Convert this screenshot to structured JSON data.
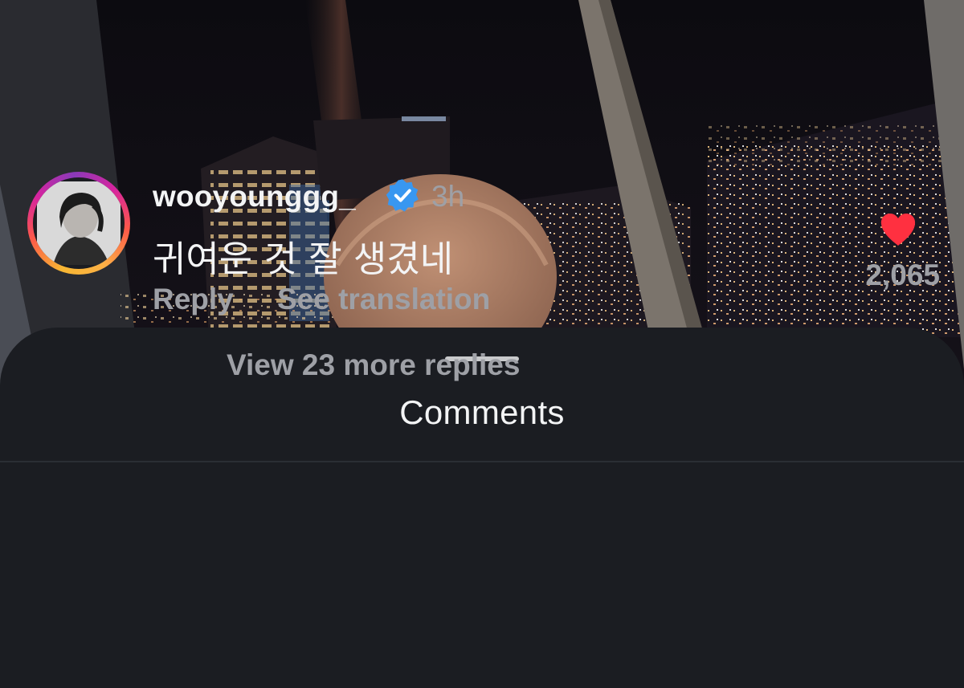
{
  "sheet": {
    "title": "Comments"
  },
  "comment": {
    "username": "wooyounggg_",
    "verified": true,
    "time": "3h",
    "text": "귀여운 것 잘 생겼네",
    "reply_label": "Reply",
    "translate_label": "See translation",
    "like_count": "2,065",
    "liked": true,
    "view_replies_label": "View 23 more replies"
  },
  "colors": {
    "sheet_bg": "#1b1d22",
    "text_primary": "#f3f4f5",
    "text_secondary": "#9ea0a6",
    "verified_blue": "#3897f0",
    "like_red": "#ff3040"
  },
  "icons": {
    "verified": "verified-badge-icon",
    "like": "heart-icon"
  }
}
